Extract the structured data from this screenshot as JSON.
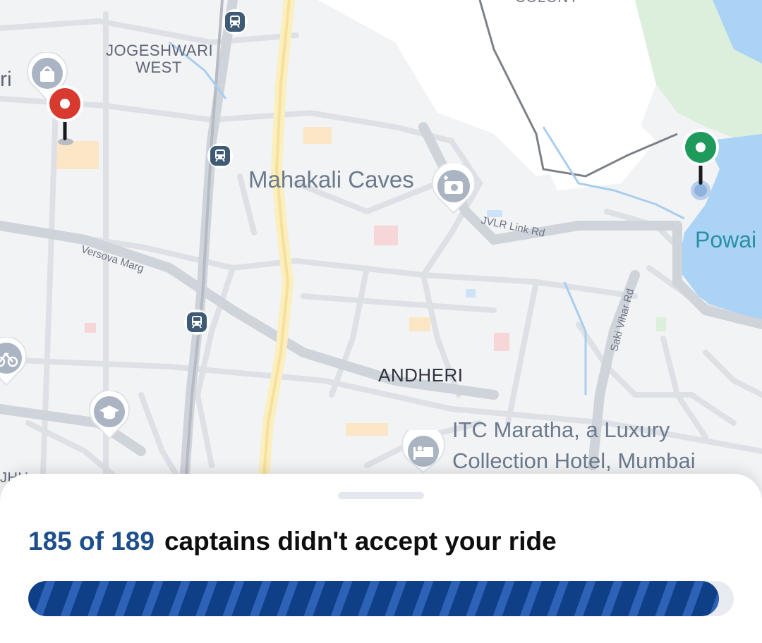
{
  "map": {
    "area_labels": [
      "JOGESHWARI",
      "WEST",
      "ANDHERI",
      "JHU",
      "COLONY"
    ],
    "poi_labels": {
      "mahakali_caves": "Mahakali Caves",
      "itc_line1": "ITC Maratha, a Luxury",
      "itc_line2": "Collection Hotel, Mumbai"
    },
    "road_labels": {
      "jvlr": "JVLR Link Rd",
      "versova": "Versova Marg",
      "saki_vihar": "Saki Vihar Rd"
    },
    "water_label": "Powai",
    "partial_label_left": "ri",
    "pins": {
      "pickup_color": "#d93a2f",
      "destination_color": "#1e9a5b"
    },
    "icons": [
      "train-station-icon",
      "shopping-bag-icon",
      "camera-icon",
      "graduation-cap-icon",
      "hotel-bed-icon",
      "bicycle-icon"
    ]
  },
  "status": {
    "count_text": "185 of 189",
    "message": "captains didn't accept your ride",
    "progress": 0.979,
    "accent_color": "#1f4f8b"
  }
}
